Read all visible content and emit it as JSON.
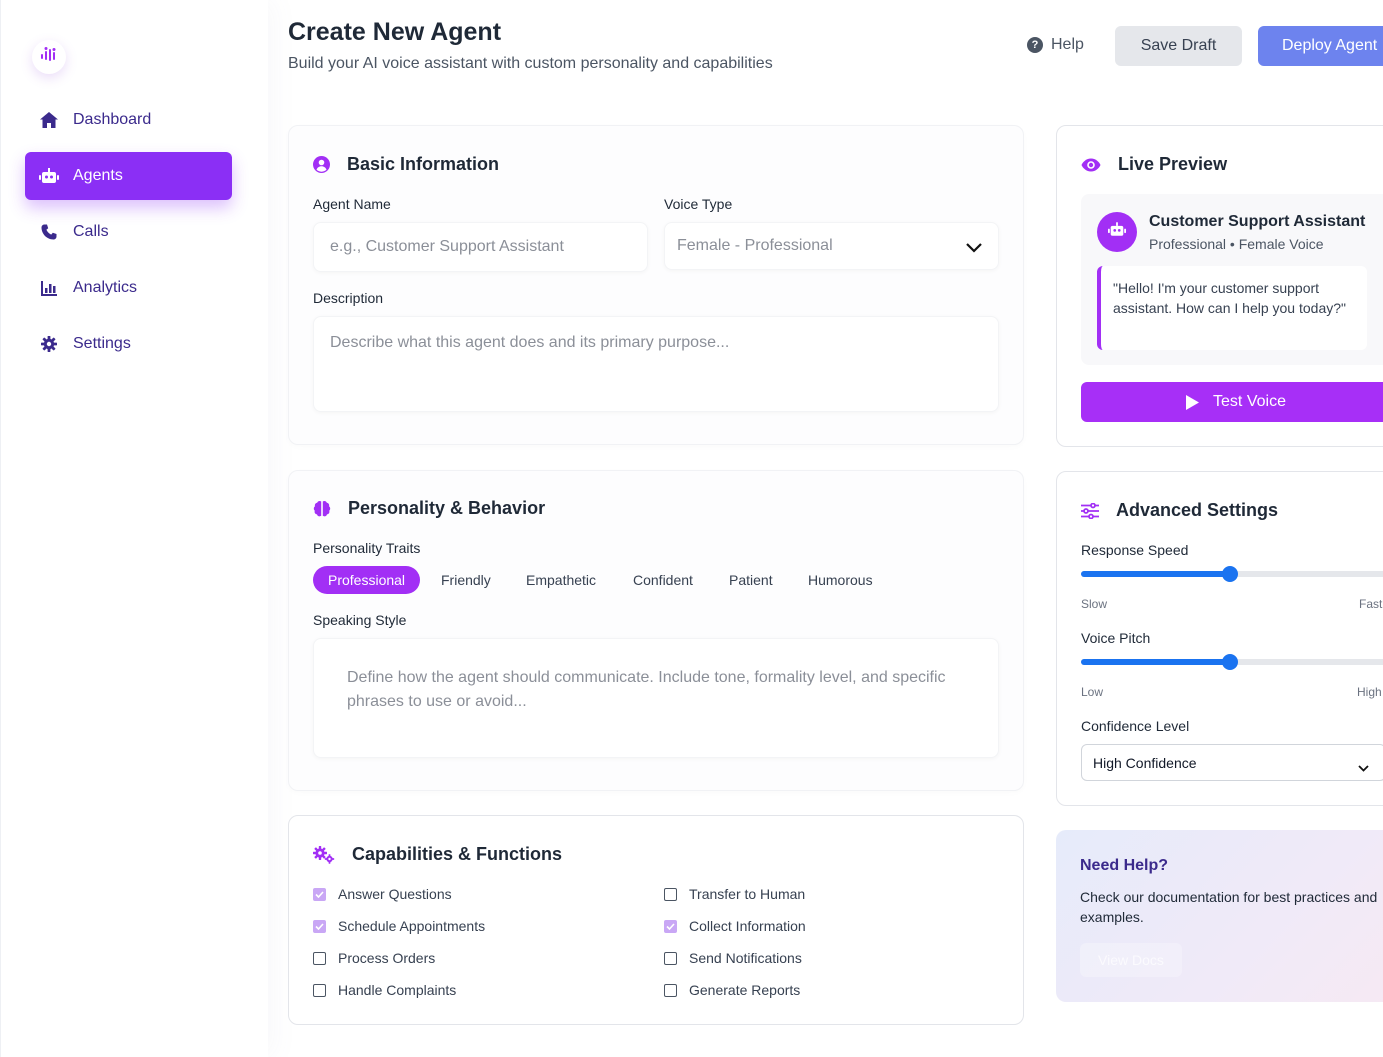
{
  "sidebar": {
    "logo_icon": "soundwave-people-icon",
    "items": [
      {
        "label": "Dashboard",
        "icon": "home-icon",
        "active": false
      },
      {
        "label": "Agents",
        "icon": "robot-icon",
        "active": true
      },
      {
        "label": "Calls",
        "icon": "phone-icon",
        "active": false
      },
      {
        "label": "Analytics",
        "icon": "bar-chart-icon",
        "active": false
      },
      {
        "label": "Settings",
        "icon": "gear-icon",
        "active": false
      }
    ]
  },
  "header": {
    "title": "Create New Agent",
    "subtitle": "Build your AI voice assistant with custom personality and capabilities",
    "help_label": "Help",
    "save_draft_label": "Save Draft",
    "deploy_label": "Deploy Agent"
  },
  "basic_info": {
    "title": "Basic Information",
    "agent_name_label": "Agent Name",
    "agent_name_placeholder": "e.g., Customer Support Assistant",
    "voice_type_label": "Voice Type",
    "voice_type_value": "Female - Professional",
    "description_label": "Description",
    "description_placeholder": "Describe what this agent does and its primary purpose..."
  },
  "personality": {
    "title": "Personality & Behavior",
    "traits_label": "Personality Traits",
    "traits": [
      {
        "label": "Professional",
        "selected": true
      },
      {
        "label": "Friendly",
        "selected": false
      },
      {
        "label": "Empathetic",
        "selected": false
      },
      {
        "label": "Confident",
        "selected": false
      },
      {
        "label": "Patient",
        "selected": false
      },
      {
        "label": "Humorous",
        "selected": false
      }
    ],
    "speaking_style_label": "Speaking Style",
    "speaking_style_placeholder": "Define how the agent should communicate. Include tone, formality level, and specific phrases to use or avoid..."
  },
  "capabilities": {
    "title": "Capabilities & Functions",
    "items": [
      {
        "label": "Answer Questions",
        "checked": true
      },
      {
        "label": "Transfer to Human",
        "checked": false
      },
      {
        "label": "Schedule Appointments",
        "checked": true
      },
      {
        "label": "Collect Information",
        "checked": true
      },
      {
        "label": "Process Orders",
        "checked": false
      },
      {
        "label": "Send Notifications",
        "checked": false
      },
      {
        "label": "Handle Complaints",
        "checked": false
      },
      {
        "label": "Generate Reports",
        "checked": false
      }
    ]
  },
  "preview": {
    "title": "Live Preview",
    "agent_name": "Customer Support Assistant",
    "agent_meta": "Professional • Female Voice",
    "greeting": "\"Hello! I'm your customer support assistant. How can I help you today?\"",
    "test_label": "Test Voice"
  },
  "advanced": {
    "title": "Advanced Settings",
    "response_speed_label": "Response Speed",
    "response_speed_value": 0.48,
    "response_speed_min": "Slow",
    "response_speed_max": "Fast",
    "voice_pitch_label": "Voice Pitch",
    "voice_pitch_value": 0.48,
    "voice_pitch_min": "Low",
    "voice_pitch_max": "High",
    "confidence_label": "Confidence Level",
    "confidence_value": "High Confidence"
  },
  "help_card": {
    "title": "Need Help?",
    "text": "Check our documentation for best practices and examples.",
    "button_label": "View Docs"
  },
  "colors": {
    "accent": "#a22ff5",
    "nav_active": "#8b2ff5",
    "deploy": "#6d83ee",
    "slider": "#1a73f0"
  }
}
